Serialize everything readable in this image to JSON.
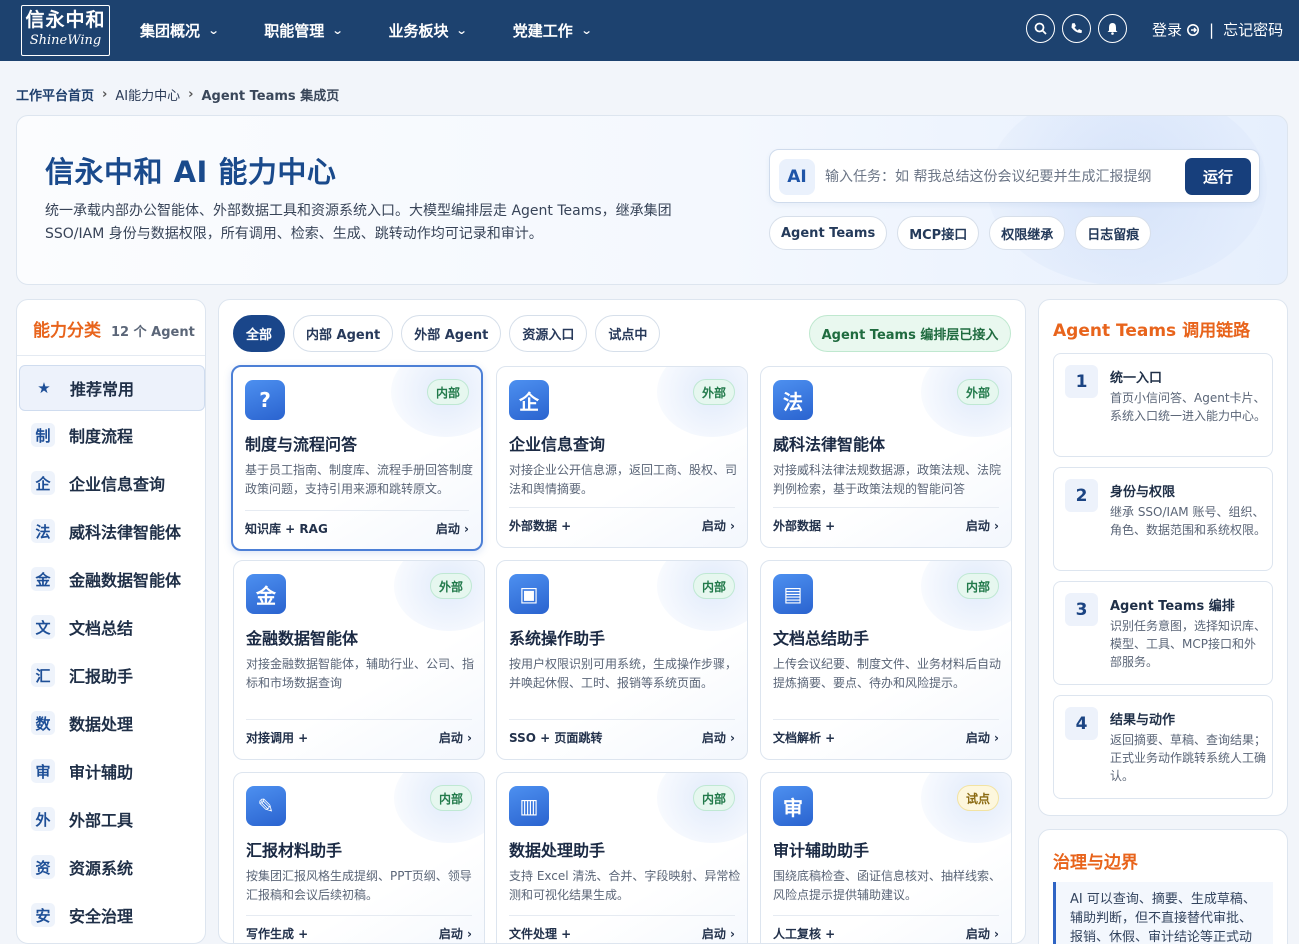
{
  "brand": {
    "logo_cn": "信永中和",
    "logo_en": "ShineWing"
  },
  "nav": [
    {
      "label": "集团概况"
    },
    {
      "label": "职能管理"
    },
    {
      "label": "业务板块"
    },
    {
      "label": "党建工作"
    }
  ],
  "header_actions": {
    "login": "登录",
    "separator": "|",
    "forgot": "忘记密码"
  },
  "breadcrumb": [
    "工作平台首页",
    "AI能力中心",
    "Agent Teams 集成页"
  ],
  "hero": {
    "title": "信永中和 AI 能力中心",
    "description": "统一承载内部办公智能体、外部数据工具和资源系统入口。大模型编排层走 Agent Teams，继承集团 SSO/IAM 身份与数据权限，所有调用、检索、生成、跳转动作均可记录和审计。",
    "ai_badge": "AI",
    "task_placeholder": "输入任务：如 帮我总结这份会议纪要并生成汇报提纲",
    "run_label": "运行",
    "tags": [
      "Agent Teams",
      "MCP接口",
      "权限继承",
      "日志留痕"
    ]
  },
  "sidebar": {
    "title": "能力分类",
    "count": "12 个 Agent",
    "items": [
      {
        "icon": "★",
        "label": "推荐常用"
      },
      {
        "icon": "制",
        "label": "制度流程"
      },
      {
        "icon": "企",
        "label": "企业信息查询"
      },
      {
        "icon": "法",
        "label": "威科法律智能体"
      },
      {
        "icon": "金",
        "label": "金融数据智能体"
      },
      {
        "icon": "文",
        "label": "文档总结"
      },
      {
        "icon": "汇",
        "label": "汇报助手"
      },
      {
        "icon": "数",
        "label": "数据处理"
      },
      {
        "icon": "审",
        "label": "审计辅助"
      },
      {
        "icon": "外",
        "label": "外部工具"
      },
      {
        "icon": "资",
        "label": "资源系统"
      },
      {
        "icon": "安",
        "label": "安全治理"
      }
    ]
  },
  "filters": [
    "全部",
    "内部 Agent",
    "外部 Agent",
    "资源入口",
    "试点中"
  ],
  "status_pill": "Agent Teams 编排层已接入",
  "cards": [
    {
      "icon": "?",
      "badge": "内部",
      "title": "制度与流程问答",
      "desc": "基于员工指南、制度库、流程手册回答制度政策问题，支持引用来源和跳转原文。",
      "foot": "知识库 + RAG",
      "action": "启动 ›"
    },
    {
      "icon": "企",
      "badge": "外部",
      "title": "企业信息查询",
      "desc": "对接企业公开信息源，返回工商、股权、司法和舆情摘要。",
      "foot": "外部数据 +",
      "action": "启动 ›"
    },
    {
      "icon": "法",
      "badge": "外部",
      "title": "威科法律智能体",
      "desc": "对接威科法律法规数据源，政策法规、法院判例检索，基于政策法规的智能问答",
      "foot": "外部数据 +",
      "action": "启动 ›"
    },
    {
      "icon": "金",
      "badge": "外部",
      "title": "金融数据智能体",
      "desc": "对接金融数据智能体，辅助行业、公司、指标和市场数据查询",
      "foot": "对接调用 +",
      "action": "启动 ›"
    },
    {
      "icon": "▣",
      "badge": "内部",
      "title": "系统操作助手",
      "desc": "按用户权限识别可用系统，生成操作步骤，并唤起休假、工时、报销等系统页面。",
      "foot": "SSO + 页面跳转",
      "action": "启动 ›"
    },
    {
      "icon": "▤",
      "badge": "内部",
      "title": "文档总结助手",
      "desc": "上传会议纪要、制度文件、业务材料后自动提炼摘要、要点、待办和风险提示。",
      "foot": "文档解析 +",
      "action": "启动 ›"
    },
    {
      "icon": "✎",
      "badge": "内部",
      "title": "汇报材料助手",
      "desc": "按集团汇报风格生成提纲、PPT页纲、领导汇报稿和会议后续初稿。",
      "foot": "写作生成 +",
      "action": "启动 ›"
    },
    {
      "icon": "▥",
      "badge": "内部",
      "title": "数据处理助手",
      "desc": "支持 Excel 清洗、合并、字段映射、异常检测和可视化结果生成。",
      "foot": "文件处理 +",
      "action": "启动 ›"
    },
    {
      "icon": "审",
      "badge": "试点",
      "title": "审计辅助助手",
      "desc": "围绕底稿检查、函证信息核对、抽样线索、风险点提示提供辅助建议。",
      "foot": "人工复核 +",
      "action": "启动 ›"
    }
  ],
  "chain": {
    "title": "Agent Teams 调用链路",
    "steps": [
      {
        "num": "1",
        "title": "统一入口",
        "desc": "首页小信问答、Agent卡片、系统入口统一进入能力中心。"
      },
      {
        "num": "2",
        "title": "身份与权限",
        "desc": "继承 SSO/IAM 账号、组织、角色、数据范围和系统权限。"
      },
      {
        "num": "3",
        "title": "Agent Teams 编排",
        "desc": "识别任务意图，选择知识库、模型、工具、MCP接口和外部服务。"
      },
      {
        "num": "4",
        "title": "结果与动作",
        "desc": "返回摘要、草稿、查询结果；正式业务动作跳转系统人工确认。"
      }
    ]
  },
  "governance": {
    "title": "治理与边界",
    "note": "AI 可以查询、摘要、生成草稿、辅助判断，但不直接替代审批、报销、休假、审计结论等正式动作。"
  },
  "colors": {
    "nav_bg": "#1d426f",
    "accent_orange": "#e8641c",
    "primary": "#1a468a"
  }
}
